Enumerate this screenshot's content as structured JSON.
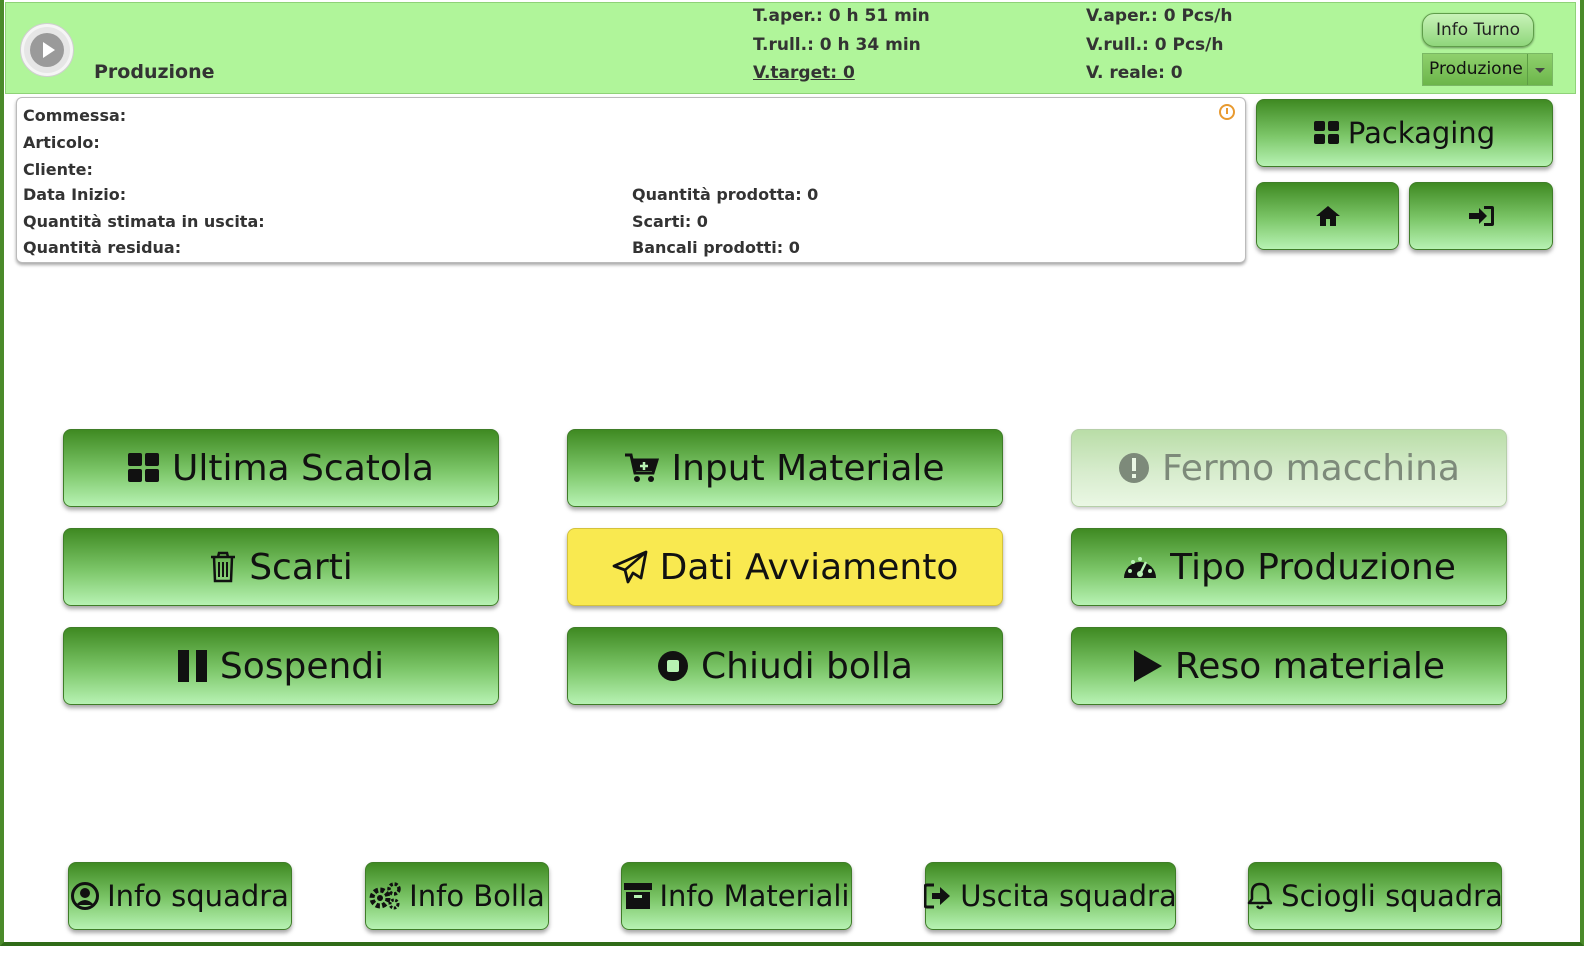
{
  "header": {
    "title": "Produzione",
    "t_aper": "T.aper.: 0 h 51 min",
    "t_rull": "T.rull.: 0 h 34 min",
    "v_target": "V.target: 0",
    "v_aper": "V.aper.: 0 Pcs/h",
    "v_rull": "V.rull.: 0 Pcs/h",
    "v_reale": "V. reale: 0",
    "info_turno": "Info Turno",
    "mode_select": "Produzione"
  },
  "info_panel": {
    "commessa": "Commessa:",
    "articolo": "Articolo:",
    "cliente": "Cliente:",
    "data_inizio": "Data Inizio:",
    "qta_stimata": "Quantità stimata in uscita:",
    "qta_residua": "Quantità residua:",
    "qta_prodotta": "Quantità prodotta: 0",
    "scarti": "Scarti: 0",
    "bancali": "Bancali prodotti: 0"
  },
  "side": {
    "packaging": "Packaging"
  },
  "actions": {
    "ultima_scatola": "Ultima Scatola",
    "input_materiale": "Input Materiale",
    "fermo_macchina": "Fermo macchina",
    "scarti": "Scarti",
    "dati_avviamento": "Dati Avviamento",
    "tipo_produzione": "Tipo Produzione",
    "sospendi": "Sospendi",
    "chiudi_bolla": "Chiudi bolla",
    "reso_materiale": "Reso materiale"
  },
  "footer": {
    "info_squadra": "Info squadra",
    "info_bolla": "Info Bolla",
    "info_materiali": "Info Materiali",
    "uscita_squadra": "Uscita squadra",
    "sciogli_squadra": "Sciogli squadra"
  },
  "colors": {
    "header_bg": "#b0f59a",
    "highlight": "#f9e950",
    "button_dark": "#3f8a22",
    "button_light": "#b7f2b3"
  }
}
